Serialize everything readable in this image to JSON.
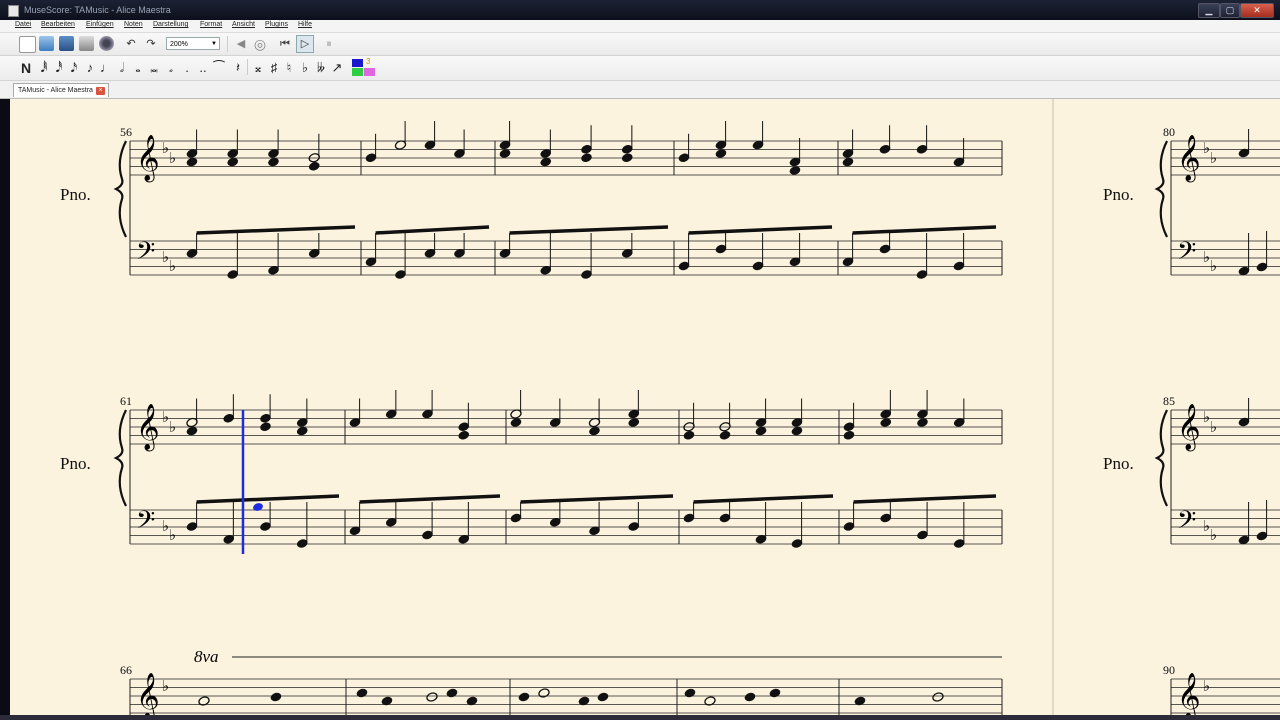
{
  "window": {
    "title": "MuseScore: TAMusic - Alice Maestra"
  },
  "menu": [
    "Datei",
    "Bearbeiten",
    "Einfügen",
    "Noten",
    "Darstellung",
    "Format",
    "Ansicht",
    "Plugins",
    "Hilfe"
  ],
  "toolbar": {
    "zoom_value": "200%",
    "icons": [
      "new-file-icon",
      "open-file-icon",
      "save-icon",
      "print-icon",
      "share-icon",
      "undo-icon",
      "redo-icon",
      "speaker-icon",
      "metronome-icon",
      "rewind-icon",
      "play-icon",
      "pause-icon"
    ]
  },
  "note_input": {
    "mode_label": "N",
    "voice_number": "3",
    "voice_colors": [
      "#1a1acc",
      "#2ecc40",
      "#e066e0"
    ]
  },
  "tab": {
    "label": "TAMusic - Alice Maestra",
    "close_glyph": "×"
  },
  "score": {
    "instrument_abbrev": "Pno.",
    "octave_marking": "8va",
    "systems_left": [
      {
        "measure_number": "56"
      },
      {
        "measure_number": "61"
      },
      {
        "measure_number": "66"
      }
    ],
    "systems_right": [
      {
        "measure_number": "80"
      },
      {
        "measure_number": "85"
      },
      {
        "measure_number": "90"
      }
    ]
  }
}
